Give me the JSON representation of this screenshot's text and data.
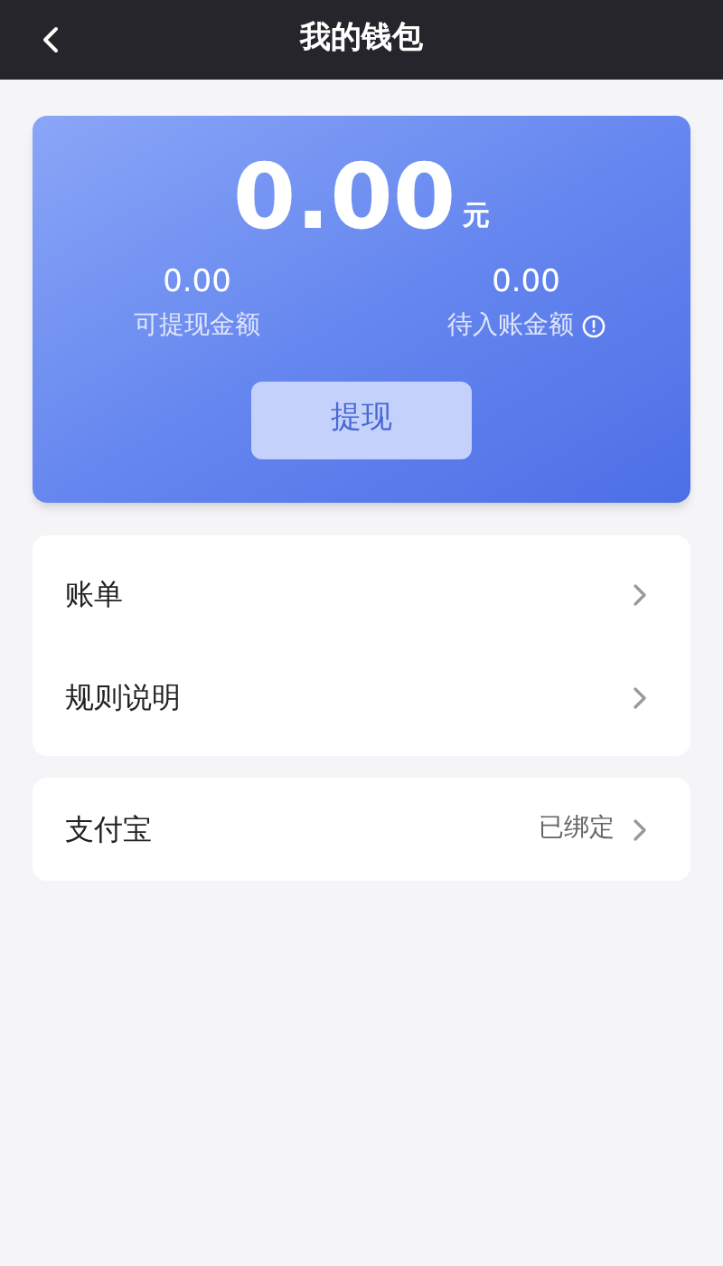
{
  "header": {
    "title": "我的钱包"
  },
  "wallet": {
    "balance": "0.00",
    "unit": "元",
    "stats": [
      {
        "value": "0.00",
        "label": "可提现金额",
        "info": false
      },
      {
        "value": "0.00",
        "label": "待入账金额",
        "info": true
      }
    ],
    "withdraw_button": "提现"
  },
  "menu": [
    {
      "label": "账单"
    },
    {
      "label": "规则说明"
    }
  ],
  "binding": {
    "label": "支付宝",
    "status": "已绑定"
  }
}
